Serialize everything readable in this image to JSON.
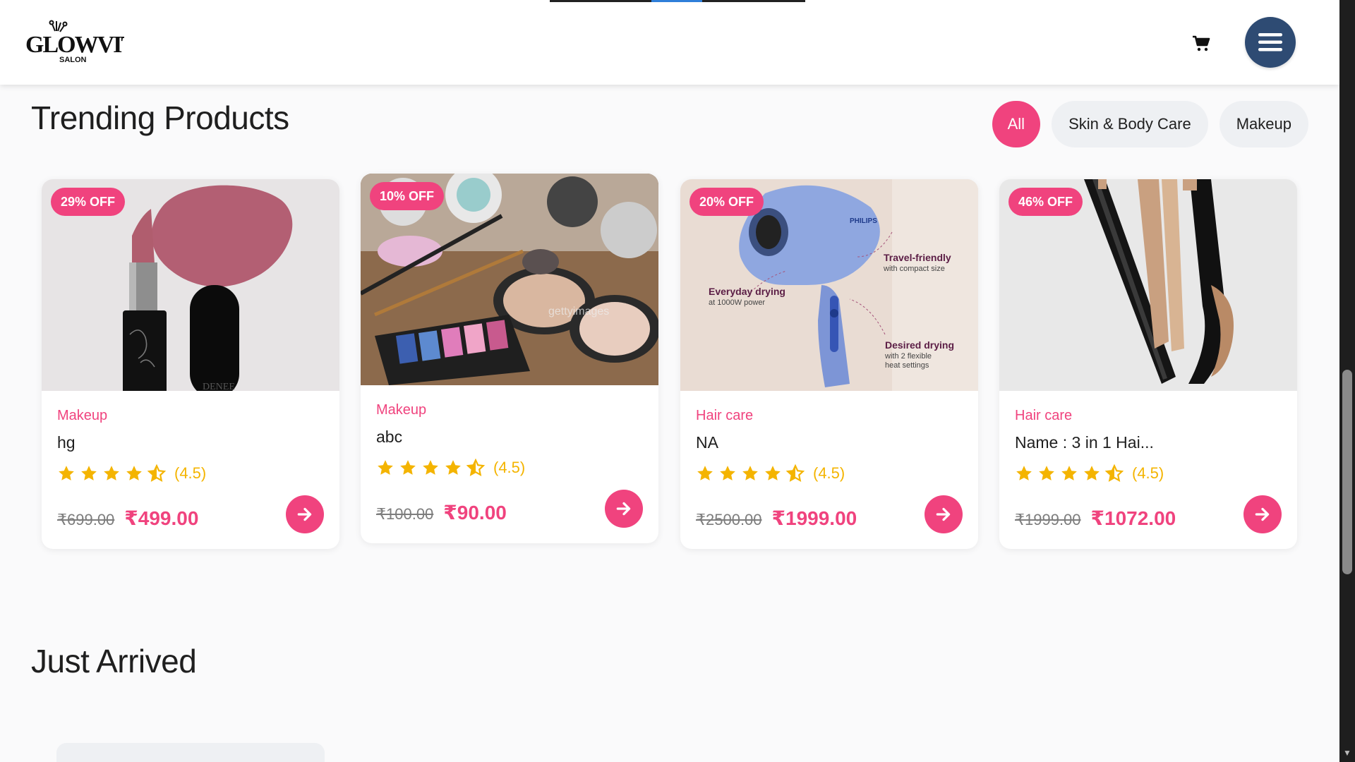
{
  "header": {
    "logo_text": "GLOWVITA",
    "logo_sub": "SALON"
  },
  "trending": {
    "title": "Trending Products",
    "filters": [
      {
        "label": "All",
        "active": true
      },
      {
        "label": "Skin & Body Care",
        "active": false
      },
      {
        "label": "Makeup",
        "active": false
      }
    ],
    "products": [
      {
        "discount": "29% OFF",
        "category": "Makeup",
        "name": "hg",
        "rating": 4.5,
        "rating_text": "(4.5)",
        "old_price": "₹699.00",
        "price": "₹499.00",
        "image": "lipstick"
      },
      {
        "discount": "10% OFF",
        "category": "Makeup",
        "name": "abc",
        "rating": 4.5,
        "rating_text": "(4.5)",
        "old_price": "₹100.00",
        "price": "₹90.00",
        "image": "makeup-kit"
      },
      {
        "discount": "20% OFF",
        "category": "Hair care",
        "name": "NA",
        "rating": 4.5,
        "rating_text": "(4.5)",
        "old_price": "₹2500.00",
        "price": "₹1999.00",
        "image": "hair-dryer",
        "image_text": {
          "brand": "PHILIPS",
          "f1_title": "Travel-friendly",
          "f1_sub": "with compact size",
          "f2_title": "Everyday drying",
          "f2_sub": "at 1000W power",
          "f3_title": "Desired drying",
          "f3_sub1": "with 2 flexible",
          "f3_sub2": "heat settings"
        }
      },
      {
        "discount": "46% OFF",
        "category": "Hair care",
        "name": "Name : 3 in 1 Hai...",
        "rating": 4.5,
        "rating_text": "(4.5)",
        "old_price": "₹1999.00",
        "price": "₹1072.00",
        "image": "hair-styler"
      }
    ]
  },
  "arrived": {
    "title": "Just Arrived"
  },
  "colors": {
    "accent": "#f0437e",
    "star": "#f4b400",
    "menu_bg": "#2e4b73"
  }
}
